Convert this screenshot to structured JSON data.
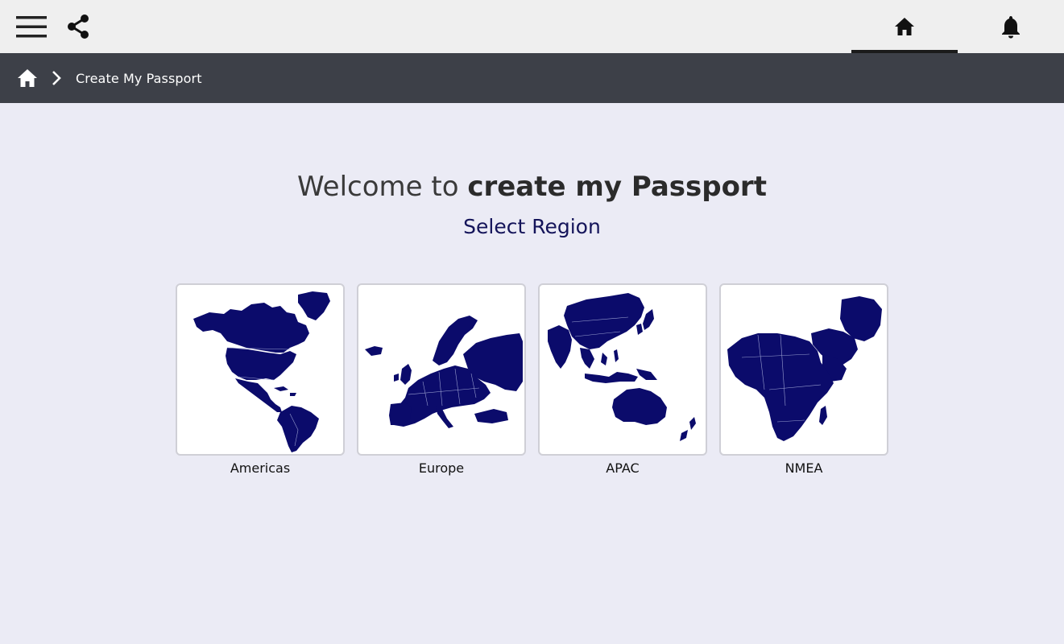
{
  "topbar": {
    "menu_icon": "hamburger-menu-icon",
    "share_icon": "share-icon",
    "tabs": [
      {
        "icon": "home-icon",
        "active": true
      },
      {
        "icon": "bell-icon",
        "active": false
      }
    ]
  },
  "breadcrumb": {
    "home_icon": "home-icon",
    "separator_icon": "chevron-right-icon",
    "current": "Create My Passport"
  },
  "main": {
    "welcome_prefix": "Welcome to ",
    "welcome_bold": "create my Passport",
    "subtitle": "Select Region",
    "regions": [
      {
        "label": "Americas",
        "icon": "americas-map-icon"
      },
      {
        "label": "Europe",
        "icon": "europe-map-icon"
      },
      {
        "label": "APAC",
        "icon": "apac-map-icon"
      },
      {
        "label": "NMEA",
        "icon": "nmea-map-icon"
      }
    ]
  },
  "colors": {
    "map_fill": "#0b0b6b",
    "topbar_bg": "#efefef",
    "breadcrumb_bg": "#3d4048",
    "page_bg": "#ebebf5",
    "subtitle": "#14145a"
  }
}
